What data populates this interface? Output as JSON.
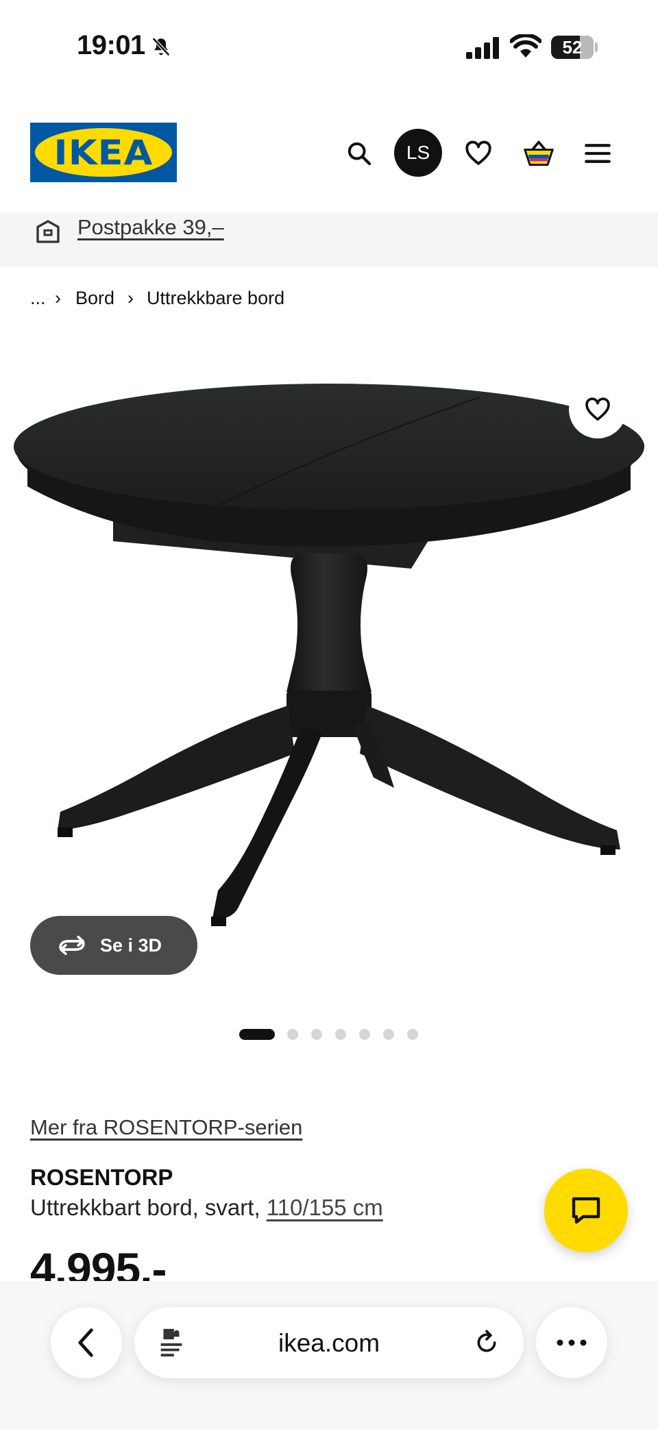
{
  "status_bar": {
    "time": "19:01",
    "battery": "52",
    "battery_level": 0.52,
    "icons": [
      "bell-slash-icon",
      "cellular-signal-icon",
      "wifi-icon",
      "battery-icon"
    ]
  },
  "header": {
    "logo_text": "IKEA",
    "avatar_initials": "LS",
    "icons": [
      "search-icon",
      "heart-icon",
      "cart-icon",
      "menu-icon"
    ]
  },
  "delivery_banner": {
    "icon": "delivery-box-icon",
    "link_text": "Postpakke 39,–"
  },
  "breadcrumb": {
    "items": [
      "...",
      "Bord",
      "Uttrekkbare bord"
    ],
    "separator": "›"
  },
  "product_gallery": {
    "image_subject": "black round extendable pedestal table",
    "see_3d_label": "Se i 3D",
    "image_count": 7,
    "active_index": 0
  },
  "product": {
    "series_link": "Mer fra ROSENTORP-serien",
    "name": "ROSENTORP",
    "description": "Uttrekkbart bord, svart,",
    "size_link": "110/155 cm",
    "price": "4.995,-"
  },
  "browser": {
    "url": "ikea.com",
    "icons": [
      "back-arrow-icon",
      "page-menu-icon",
      "reload-icon",
      "more-dots-icon"
    ]
  },
  "colors": {
    "ikea_blue": "#0058a3",
    "ikea_yellow": "#ffdb00",
    "text": "#111111",
    "banner_bg": "#f5f5f5"
  }
}
